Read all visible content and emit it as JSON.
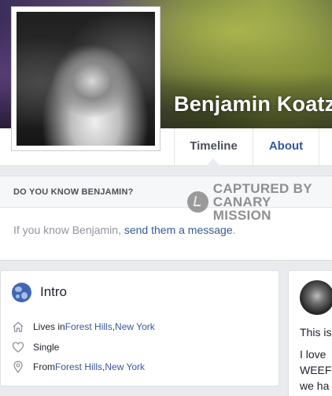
{
  "profile": {
    "name": "Benjamin Koatz"
  },
  "tabs": {
    "timeline": "Timeline",
    "about": "About"
  },
  "know_box": {
    "title": "DO YOU KNOW BENJAMIN?",
    "body_prefix": "If you know Benjamin, ",
    "link": "send them a message",
    "body_suffix": "."
  },
  "watermark": {
    "line1": "CAPTURED BY",
    "line2": "CANARY MISSION"
  },
  "intro": {
    "title": "Intro",
    "lives_prefix": "Lives in ",
    "lives_city": "Forest Hills",
    "lives_sep": ", ",
    "lives_state": "New York",
    "relationship": "Single",
    "from_prefix": "From ",
    "from_city": "Forest Hills",
    "from_sep": ", ",
    "from_state": "New York"
  },
  "post": {
    "line1": "This is",
    "line2": "I love",
    "line3": "WEEF",
    "line4": "we ha"
  },
  "colors": {
    "link": "#365899",
    "brand_blue": "#4267b2",
    "page_bg": "#e9ebee"
  }
}
